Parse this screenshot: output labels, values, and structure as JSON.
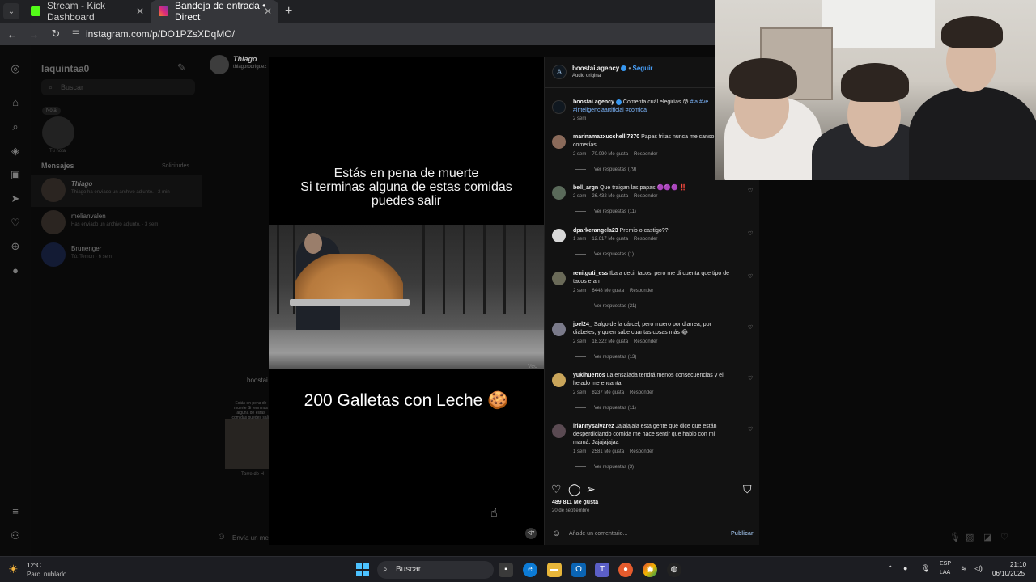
{
  "browser": {
    "tabs": [
      {
        "label": "Stream - Kick Dashboard",
        "close": "✕"
      },
      {
        "label": "Bandeja de entrada • Direct",
        "close": "✕"
      }
    ],
    "new_tab": "+",
    "url": "instagram.com/p/DO1PZsXDqMO/"
  },
  "dm": {
    "username": "laquintaa0",
    "search_placeholder": "Buscar",
    "note_bubble": "Nota",
    "note_label": "Tu nota",
    "messages_label": "Mensajes",
    "requests_label": "Solicitudes",
    "conversations": [
      {
        "name": "Thiago",
        "preview": "Thiago ha enviado un archivo adjunto. · 2 min"
      },
      {
        "name": "melianvalen",
        "preview": "Has enviado un archivo adjunto. · 3 sem"
      },
      {
        "name": "Brunenger",
        "preview": "Tú: Temon · 6 sem"
      }
    ]
  },
  "chat": {
    "header_name": "Thiago",
    "header_sub": "thiagorodriguez",
    "card_user": "boostai",
    "card_text": "Estás en pena de muerte Si terminas alguna de estas comidas puedes salir",
    "card_caption": "Torre de H",
    "input_placeholder": "Envía un mensaje..."
  },
  "video": {
    "caption_top": "Estás en pena de muerte\nSi terminas alguna de estas comidas\npuedes salir",
    "caption_bottom": "200 Galletas con Leche 🍪",
    "watermark": "Veo"
  },
  "post": {
    "author": "boostai.agency",
    "follow": "Seguir",
    "audio": "Audio original",
    "caption_author": "boostai.agency",
    "caption_text": "Comenta cuál elegirías 😰",
    "caption_tags": "#ia #ve",
    "caption_tags2": "#inteligenciaartificial #comida",
    "caption_time": "2 sem",
    "comments": [
      {
        "user": "marinamazxucchelli7370",
        "text": "Papas fritas nunca me canso",
        "text2": "comerías",
        "time": "2 sem",
        "likes": "70.090 Me gusta",
        "reply": "Responder",
        "replies": "Ver respuestas (79)"
      },
      {
        "user": "bell_argn",
        "text": "Que traigan las papas 🟣🟣🟣 ‼️",
        "text2": "",
        "time": "2 sem",
        "likes": "26.432 Me gusta",
        "reply": "Responder",
        "replies": "Ver respuestas (11)"
      },
      {
        "user": "dparkerangela23",
        "text": "Premio o castigo??",
        "text2": "",
        "time": "1 sem",
        "likes": "12.617 Me gusta",
        "reply": "Responder",
        "replies": "Ver respuestas (1)"
      },
      {
        "user": "reni.guti_ess",
        "text": "Iba a decir tacos, pero me di cuenta que tipo de",
        "text2": "tacos eran",
        "time": "2 sem",
        "likes": "6448 Me gusta",
        "reply": "Responder",
        "replies": "Ver respuestas (21)"
      },
      {
        "user": "joel24_",
        "text": "Salgo de la cárcel, pero muero por diarrea, por",
        "text2": "diabetes, y quien sabe cuantas cosas más 😂",
        "time": "2 sem",
        "likes": "18.322 Me gusta",
        "reply": "Responder",
        "replies": "Ver respuestas (13)"
      },
      {
        "user": "yukihuertos",
        "text": "La ensalada tendrá menos consecuencias y el",
        "text2": "helado me encanta",
        "time": "2 sem",
        "likes": "8237 Me gusta",
        "reply": "Responder",
        "replies": "Ver respuestas (11)"
      },
      {
        "user": "iriannysalvarez",
        "text": "Jajajajaja esta gente que dice que están",
        "text2": "desperdiciando comida me hace sentir que hablo con mi",
        "text3": "mamá. Jajajajajaa",
        "time": "1 sem",
        "likes": "2581 Me gusta",
        "reply": "Responder",
        "replies": "Ver respuestas (3)"
      }
    ],
    "likes": "489 811 Me gusta",
    "date": "20 de septiembre",
    "add_comment": "Añade un comentario...",
    "publish": "Publicar"
  },
  "taskbar": {
    "temp": "12°C",
    "weather": "Parc. nublado",
    "search": "Buscar",
    "lang1": "ESP",
    "lang2": "LAA",
    "time": "21:10",
    "date": "06/10/2025"
  },
  "colors": {
    "accent": "#3797f0",
    "kick": "#53fc18",
    "instagram": "#e1306c"
  }
}
